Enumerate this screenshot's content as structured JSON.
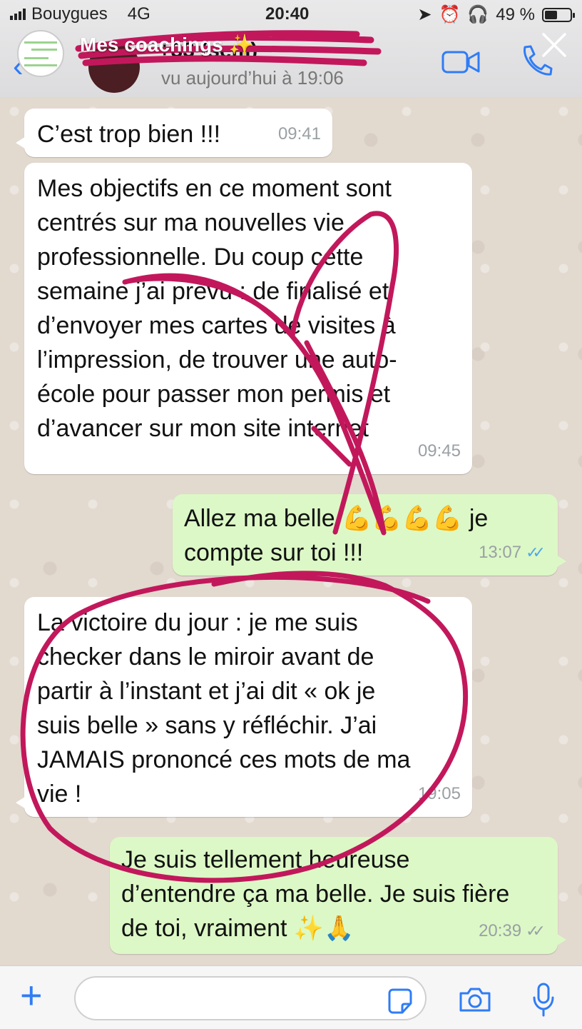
{
  "status_bar": {
    "carrier": "Bouygues",
    "network": "4G",
    "time": "20:40",
    "battery": "49 %",
    "battery_level": 0.49
  },
  "story": {
    "title": "Mes coachings ✨"
  },
  "chat_header": {
    "back_count": "2",
    "contact_name": "+33 (sem)",
    "last_seen": "vu aujourd’hui à 19:06"
  },
  "messages": [
    {
      "direction": "in",
      "text": "C’est trop bien !!!",
      "time": "09:41"
    },
    {
      "direction": "in",
      "text": "Mes objectifs en ce moment sont\ncentrés sur ma nouvelles vie\nprofessionnelle. Du coup cette\nsemaine j’ai prevu : de finalisé et\nd’envoyer mes cartes de visites à\nl’impression, de trouver une auto-\nécole pour passer mon permis et\nd’avancer sur mon site internet",
      "time": "09:45"
    },
    {
      "direction": "out",
      "text": "Allez ma belle 💪💪💪💪 je\ncompte sur toi !!!",
      "time": "13:07",
      "status": "read"
    },
    {
      "direction": "in",
      "text": "La victoire du jour : je me suis\nchecker dans le miroir avant de\npartir à l’instant et j’ai dit « ok je\nsuis belle » sans y réfléchir. J’ai\nJAMAIS prononcé ces mots de ma\nvie !",
      "time": "19:05"
    },
    {
      "direction": "out",
      "text": "Je suis tellement heureuse\nd’entendre ça ma belle. Je suis fière\nde toi, vraiment ✨🙏",
      "time": "20:39",
      "status": "delivered"
    }
  ],
  "input": {
    "placeholder": "",
    "value": ""
  },
  "icons": {
    "video": "video-camera-icon",
    "phone": "phone-icon",
    "close": "close-icon",
    "plus": "plus-icon",
    "sticker": "sticker-icon",
    "camera": "camera-icon",
    "mic": "microphone-icon"
  },
  "colors": {
    "accent": "#2f7cf6",
    "incoming_bubble": "#ffffff",
    "outgoing_bubble": "#dcf8c6",
    "annotation": "#c2185b",
    "read_ticks": "#4fa9e8"
  }
}
